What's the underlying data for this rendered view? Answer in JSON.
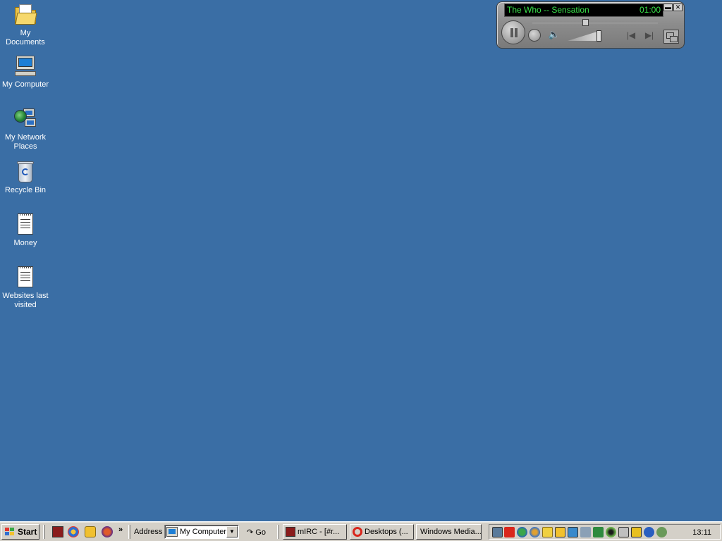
{
  "desktop": {
    "icons": [
      {
        "label": "My Documents",
        "icon": "my-documents-folder-icon"
      },
      {
        "label": "My Computer",
        "icon": "my-computer-icon"
      },
      {
        "label": "My Network Places",
        "icon": "network-places-icon"
      },
      {
        "label": "Recycle Bin",
        "icon": "recycle-bin-icon"
      },
      {
        "label": "Money",
        "icon": "text-document-icon"
      },
      {
        "label": "Websites last visited",
        "icon": "text-document-icon"
      }
    ],
    "background_color": "#3a6ea5"
  },
  "media_player": {
    "track": "The Who -- Sensation",
    "time": "01:00",
    "minimize_glyph": "▬",
    "close_glyph": "✕",
    "mute_glyph": "🔈",
    "prev_glyph": "|◀",
    "next_glyph": "▶|",
    "seek_position": 0.42,
    "volume_level": 0.85,
    "display_color": "#39e44a"
  },
  "taskbar": {
    "start_label": "Start",
    "quick_launch": [
      "mirc-icon",
      "media-player-icon",
      "clock-app-icon",
      "browser-icon"
    ],
    "chevron": "»",
    "address_label": "Address",
    "address_value": "My Computer",
    "go_label": "Go",
    "tasks": [
      {
        "label": "mIRC - [#r...",
        "icon": "mirc-icon"
      },
      {
        "label": "Desktops (...",
        "icon": "opera-icon"
      },
      {
        "label": "Windows Media...",
        "icon": ""
      }
    ],
    "tray_icons": [
      "network-tray-icon",
      "adobe-tray-icon",
      "messenger-tray-icon",
      "globe-tray-icon",
      "cat-tray-icon",
      "norton-tray-icon",
      "display-tray-icon",
      "network-connection-tray-icon",
      "wireless-tray-icon",
      "eye-tray-icon",
      "battery-tray-icon",
      "zonealarm-tray-icon",
      "accessibility-tray-icon",
      "clock-tray-icon"
    ],
    "clock": "13:11"
  }
}
